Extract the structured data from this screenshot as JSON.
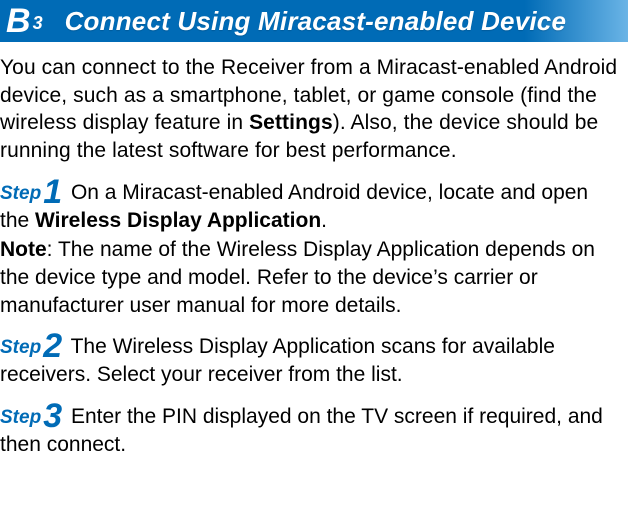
{
  "header": {
    "badge_letter": "B",
    "badge_super": "3",
    "title": "Connect Using Miracast-enabled Device"
  },
  "intro": {
    "pre": "You can connect to the Receiver from a Miracast-enabled Android device, such as a smartphone, tablet, or game console (find the wireless display feature in ",
    "bold": "Settings",
    "post": "). Also, the device should be running the latest software for best performance."
  },
  "step_label": "Step",
  "steps": [
    {
      "num": "1",
      "text_pre": " On a Miracast-enabled Android device, locate and open the ",
      "text_bold": "Wireless Display Application",
      "text_post": ".",
      "note_label": "Note",
      "note_text": ": The name of the Wireless Display Application depends on the device type and model. Refer to the device’s carrier or manufacturer user manual for more details."
    },
    {
      "num": "2",
      "text_pre": " The Wireless Display Application scans for available receivers. Select your receiver from the list.",
      "text_bold": "",
      "text_post": "",
      "note_label": "",
      "note_text": ""
    },
    {
      "num": "3",
      "text_pre": " Enter the PIN displayed on the TV screen if required, and then connect.",
      "text_bold": "",
      "text_post": "",
      "note_label": "",
      "note_text": ""
    }
  ]
}
